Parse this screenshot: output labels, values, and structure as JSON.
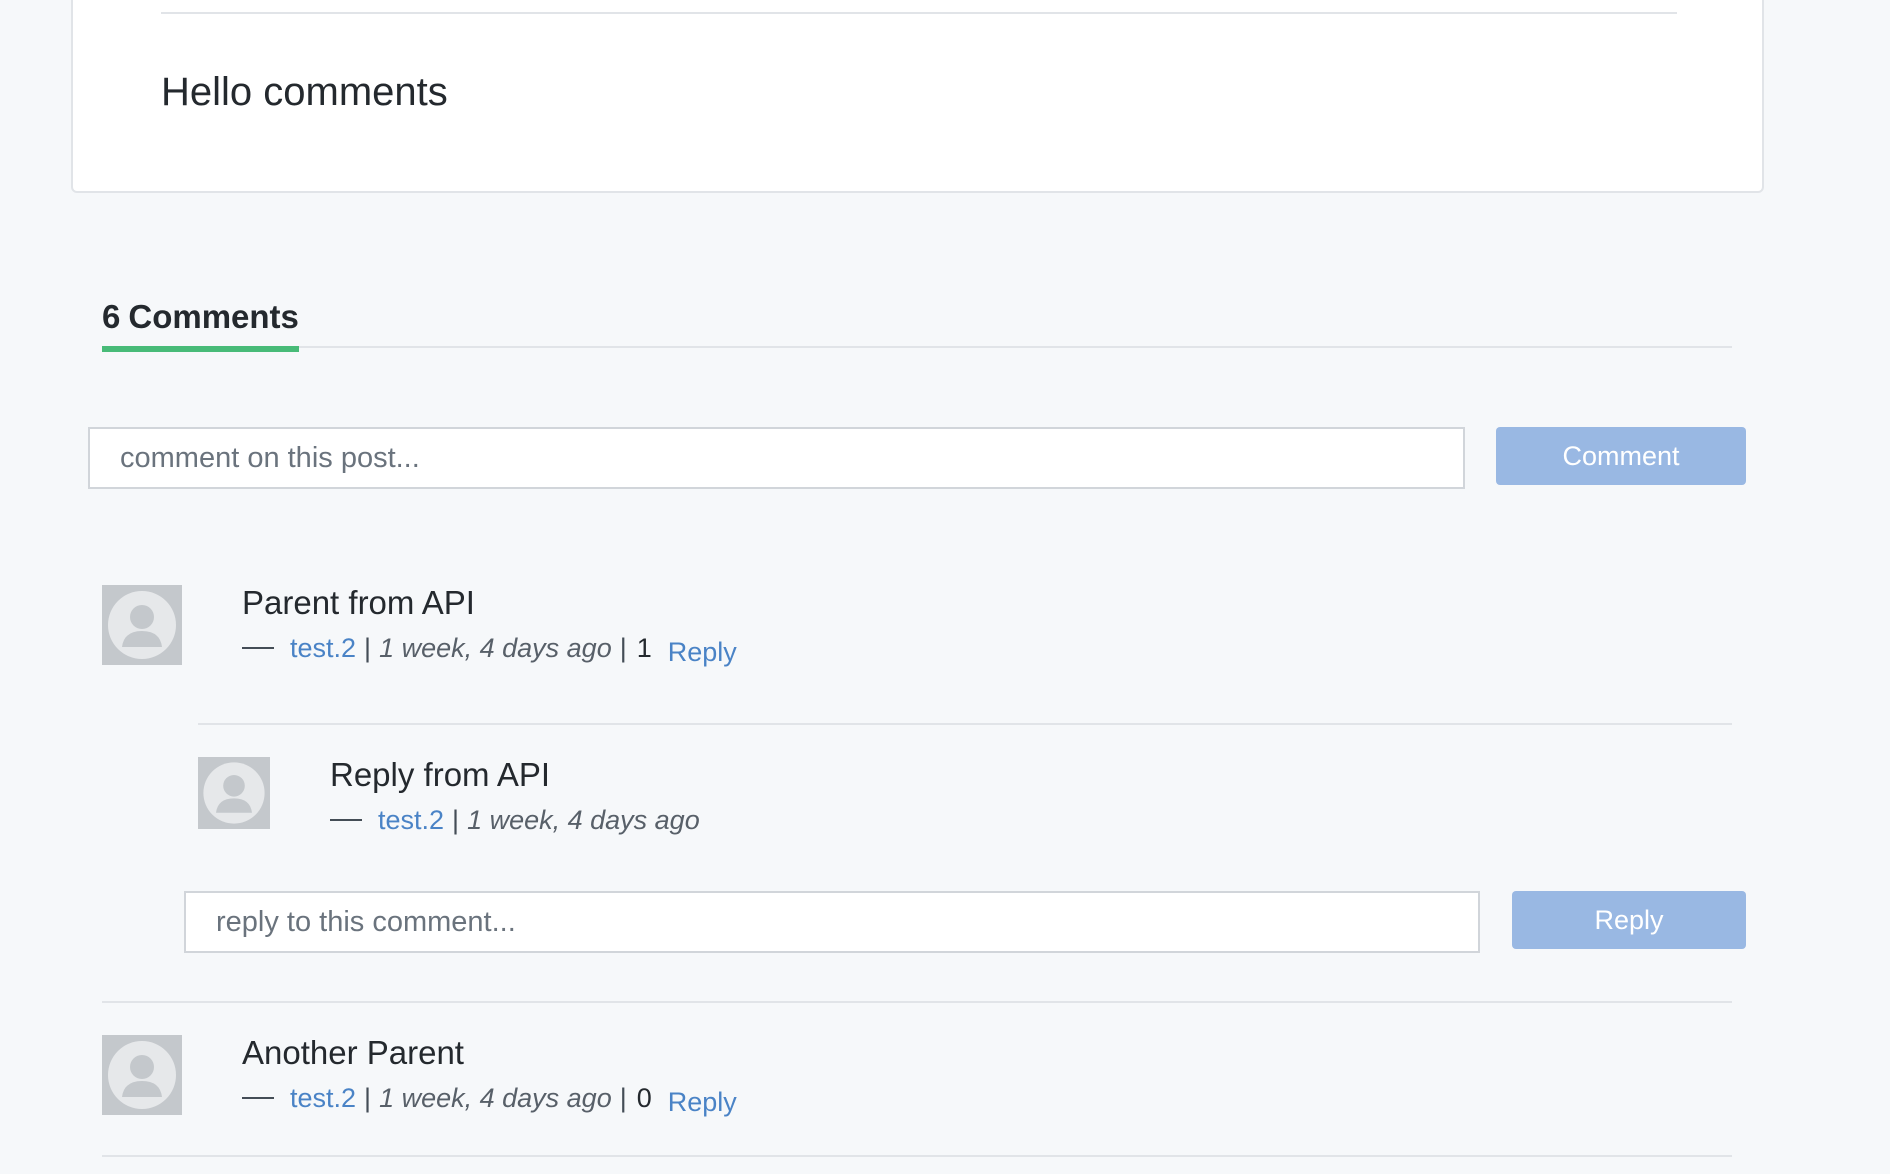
{
  "post": {
    "body": "Hello comments"
  },
  "comments_section": {
    "count": "6",
    "label": "Comments"
  },
  "new_comment": {
    "placeholder": "comment on this post...",
    "button_label": "Comment"
  },
  "comments": [
    {
      "title": "Parent from API",
      "author": "test.2",
      "time": "1 week, 4 days ago",
      "reply_count": "1",
      "reply_label": "Reply"
    },
    {
      "title": "Another Parent",
      "author": "test.2",
      "time": "1 week, 4 days ago",
      "reply_count": "0",
      "reply_label": "Reply"
    }
  ],
  "replies": [
    {
      "title": "Reply from API",
      "author": "test.2",
      "time": "1 week, 4 days ago"
    }
  ],
  "reply_form": {
    "placeholder": "reply to this comment...",
    "button_label": "Reply"
  },
  "colors": {
    "accent_underline": "#48bb78",
    "link": "#4a83c6",
    "button_disabled": "#99b8e3"
  },
  "icons": {
    "avatar": "default-user-avatar-icon"
  }
}
